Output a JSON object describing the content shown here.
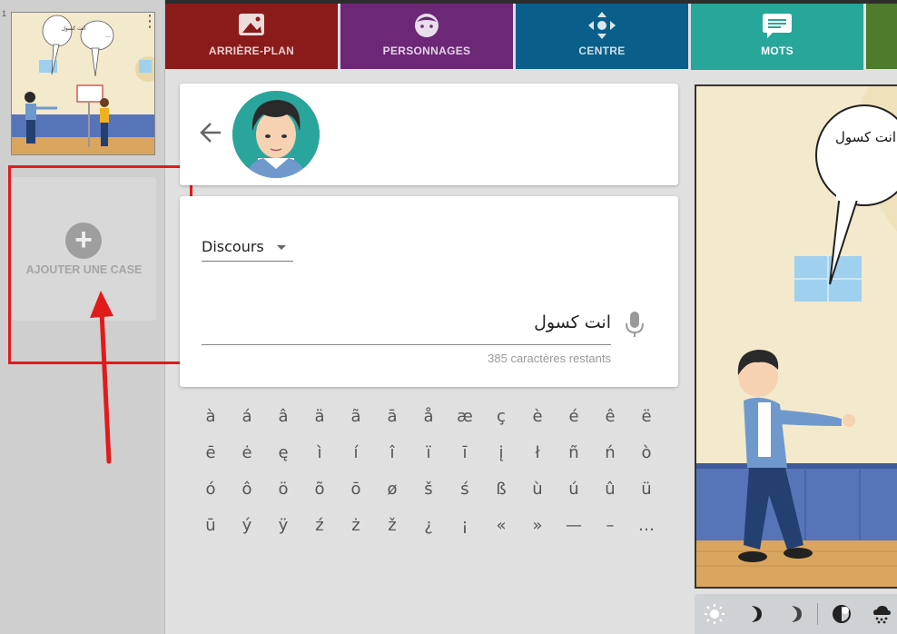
{
  "sidebar": {
    "panel_number": "1",
    "add_case_label": "AJOUTER UNE CASE",
    "thumb_speech_1": "انت كسول",
    "thumb_speech_2": "..."
  },
  "tabs": [
    {
      "label": "ARRIÈRE-PLAN",
      "icon": "image-icon",
      "color": "#8b1a1a"
    },
    {
      "label": "PERSONNAGES",
      "icon": "face-icon",
      "color": "#6c2777"
    },
    {
      "label": "CENTRE",
      "icon": "move-arrows-icon",
      "color": "#0a5f8a"
    },
    {
      "label": "MOTS",
      "icon": "speech-bubble-icon",
      "color": "#27a69a",
      "active": true
    }
  ],
  "editor": {
    "speech_type": "Discours",
    "speech_text": "انت كسول",
    "chars_remaining": "385 caractères restants"
  },
  "accents": [
    "à",
    "á",
    "â",
    "ä",
    "ã",
    "ā",
    "å",
    "æ",
    "ç",
    "è",
    "é",
    "ê",
    "ë",
    "ē",
    "ė",
    "ę",
    "ì",
    "í",
    "î",
    "ï",
    "ī",
    "į",
    "ł",
    "ñ",
    "ń",
    "ò",
    "ó",
    "ô",
    "ö",
    "õ",
    "ō",
    "ø",
    "š",
    "ś",
    "ß",
    "ù",
    "ú",
    "û",
    "ü",
    "ū",
    "ý",
    "ÿ",
    "ź",
    "ż",
    "ž",
    "¿",
    "¡",
    "«",
    "»",
    "—",
    "–",
    "…"
  ],
  "comic": {
    "bubble_text": "انت كسول"
  },
  "toolbar_icons": [
    "sun-icon",
    "moon-icon",
    "moon-icon",
    "contrast-icon",
    "weather-icon"
  ]
}
